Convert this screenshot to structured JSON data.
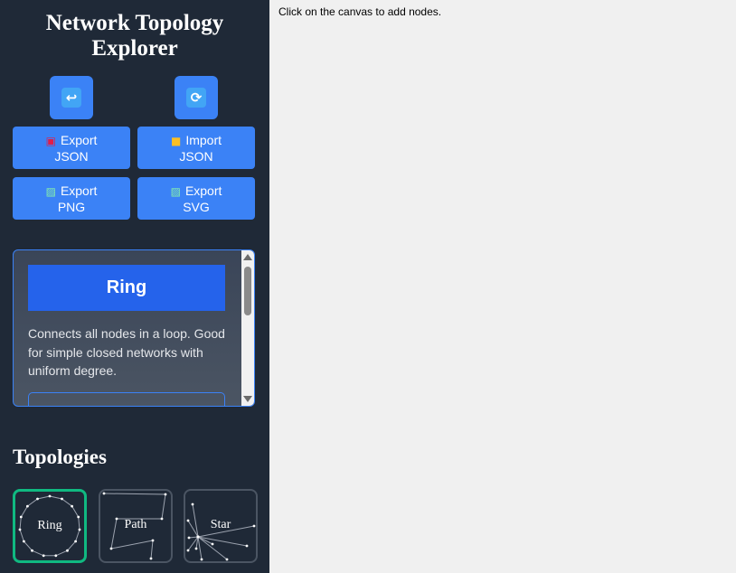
{
  "app": {
    "title": "Network Topology Explorer"
  },
  "toolbar": {
    "undo_icon": "undo-icon",
    "redo_icon": "refresh-icon",
    "export_json": {
      "icon": "floppy-disk-icon",
      "line1": "Export",
      "line2": "JSON"
    },
    "import_json": {
      "icon": "folder-icon",
      "line1": "Import",
      "line2": "JSON"
    },
    "export_png": {
      "icon": "picture-icon",
      "line1": "Export",
      "line2": "PNG"
    },
    "export_svg": {
      "icon": "picture-icon",
      "line1": "Export",
      "line2": "SVG"
    }
  },
  "info_panel": {
    "heading": "Ring",
    "description": "Connects all nodes in a loop. Good for simple closed networks with uniform degree."
  },
  "topologies": {
    "title": "Topologies",
    "items": [
      {
        "label": "Ring",
        "selected": true
      },
      {
        "label": "Path",
        "selected": false
      },
      {
        "label": "Star",
        "selected": false
      }
    ]
  },
  "canvas": {
    "hint": "Click on the canvas to add nodes."
  },
  "colors": {
    "sidebar_bg": "#1f2937",
    "button_blue": "#3b82f6",
    "heading_blue": "#2563eb",
    "selected_border": "#10b981",
    "canvas_bg": "#f0f0f0"
  }
}
